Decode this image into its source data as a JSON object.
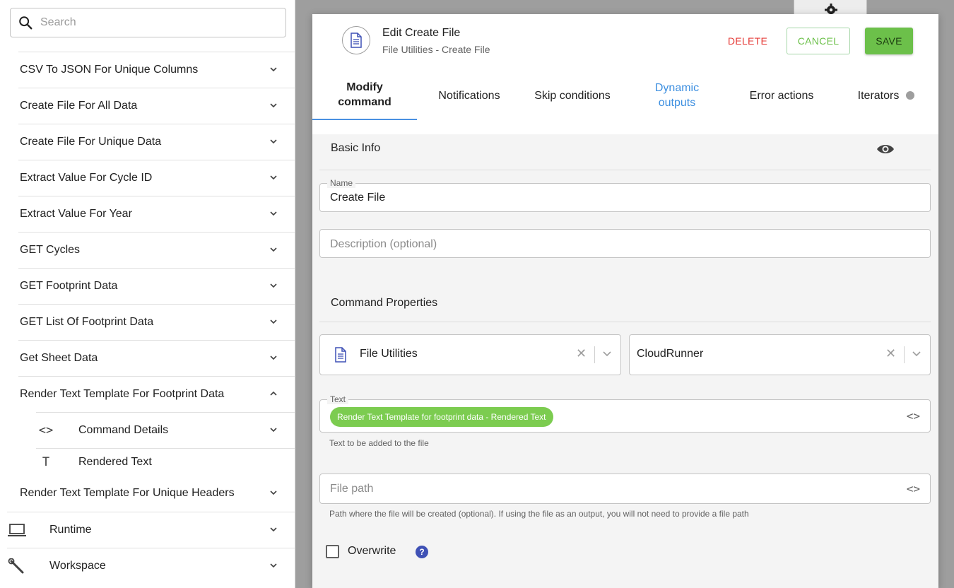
{
  "search": {
    "placeholder": "Search"
  },
  "sidebar": {
    "items": [
      {
        "label": "CSV To JSON For Unique Columns"
      },
      {
        "label": "Create File For All Data"
      },
      {
        "label": "Create File For Unique Data"
      },
      {
        "label": "Extract Value For Cycle ID"
      },
      {
        "label": "Extract Value For Year"
      },
      {
        "label": "GET Cycles"
      },
      {
        "label": "GET Footprint Data"
      },
      {
        "label": "GET List Of Footprint Data"
      },
      {
        "label": "Get Sheet Data"
      },
      {
        "label": "Render Text Template For Footprint Data",
        "expanded": true
      }
    ],
    "sub_items": [
      {
        "icon": "code-icon",
        "glyph": "<>",
        "label": "Command Details"
      },
      {
        "icon": "text-icon",
        "glyph": "T",
        "label": "Rendered Text"
      }
    ],
    "after_item": {
      "label": "Render Text Template For Unique Headers"
    },
    "top_items": [
      {
        "icon": "laptop-icon",
        "label": "Runtime"
      },
      {
        "icon": "wrench-icon",
        "label": "Workspace"
      }
    ]
  },
  "modal": {
    "title": "Edit Create File",
    "subtitle": "File Utilities - Create File",
    "delete_label": "DELETE",
    "cancel_label": "CANCEL",
    "save_label": "SAVE",
    "tabs": [
      {
        "label": "Modify command",
        "active": true
      },
      {
        "label": "Notifications"
      },
      {
        "label": "Skip conditions"
      },
      {
        "label": "Dynamic outputs"
      },
      {
        "label": "Error actions"
      },
      {
        "label": "Iterators"
      }
    ],
    "basic_info": {
      "title": "Basic Info",
      "name_label": "Name",
      "name_value": "Create File",
      "description_placeholder": "Description (optional)"
    },
    "command_properties": {
      "title": "Command Properties",
      "integration": "File Utilities",
      "runner": "CloudRunner",
      "text_label": "Text",
      "text_chip": "Render Text Template for footprint data - Rendered Text",
      "text_helper": "Text to be added to the file",
      "filepath_placeholder": "File path",
      "filepath_helper": "Path where the file will be created (optional). If using the file as an output, you will not need to provide a file path",
      "overwrite_label": "Overwrite",
      "help_glyph": "?"
    }
  },
  "colors": {
    "accent_green": "#6cc04a",
    "delete_red": "#e53935",
    "tab_blue": "#3d8fe0",
    "active_tab_underline": "#4a90e2"
  }
}
